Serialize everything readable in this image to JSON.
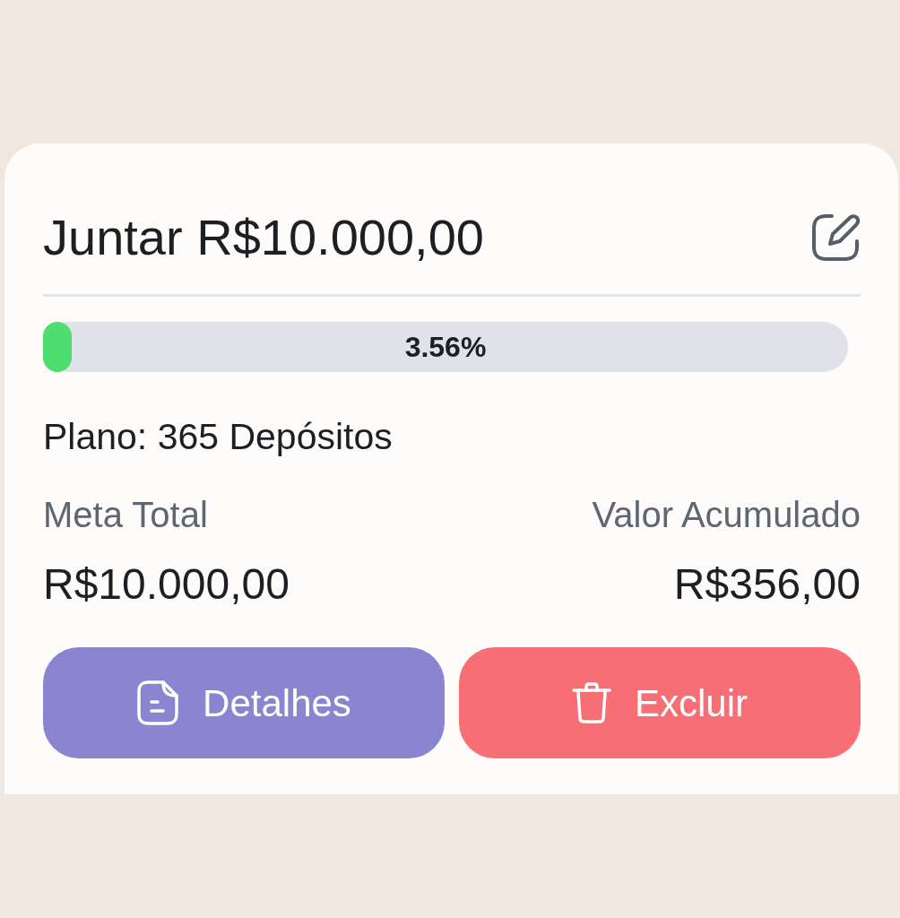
{
  "goal": {
    "title": "Juntar R$10.000,00"
  },
  "progress": {
    "level": 0.0356,
    "reading": "3.56%"
  },
  "plan": "Plano: 365 Depósitos",
  "stats": [
    {
      "label": "Meta Total",
      "value": "R$10.000,00"
    },
    {
      "label": "Valor Acumulado",
      "value": "R$356,00"
    }
  ],
  "buttons": [
    {
      "kind": "details",
      "label": "Detalhes"
    },
    {
      "kind": "delete",
      "label": "Excluir"
    }
  ]
}
